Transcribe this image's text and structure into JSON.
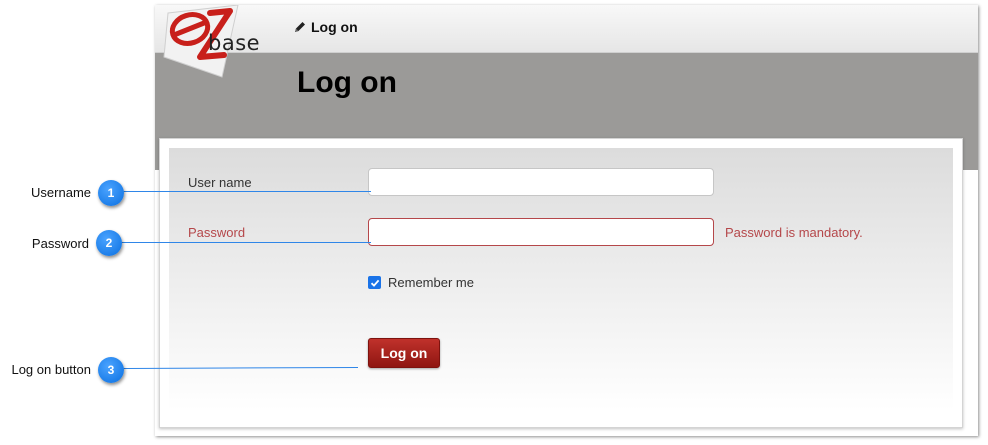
{
  "app": {
    "logo_text": "base",
    "nav_link": "Log on"
  },
  "page": {
    "title": "Log on"
  },
  "form": {
    "username_label": "User name",
    "username_value": "",
    "password_label": "Password",
    "password_value": "",
    "password_error": "Password is mandatory.",
    "remember_label": "Remember me",
    "remember_checked": true,
    "submit_label": "Log on"
  },
  "callouts": [
    {
      "number": "1",
      "label": "Username"
    },
    {
      "number": "2",
      "label": "Password"
    },
    {
      "number": "3",
      "label": "Log on button"
    }
  ],
  "colors": {
    "accent_red": "#a9201a",
    "error_red": "#b5474a",
    "callout_blue": "#1a7ef0",
    "hero_gray": "#9b9a98"
  },
  "icons": {
    "logo": "ez-logo-icon",
    "nav": "pencil-icon",
    "checkbox": "checkmark-icon"
  }
}
